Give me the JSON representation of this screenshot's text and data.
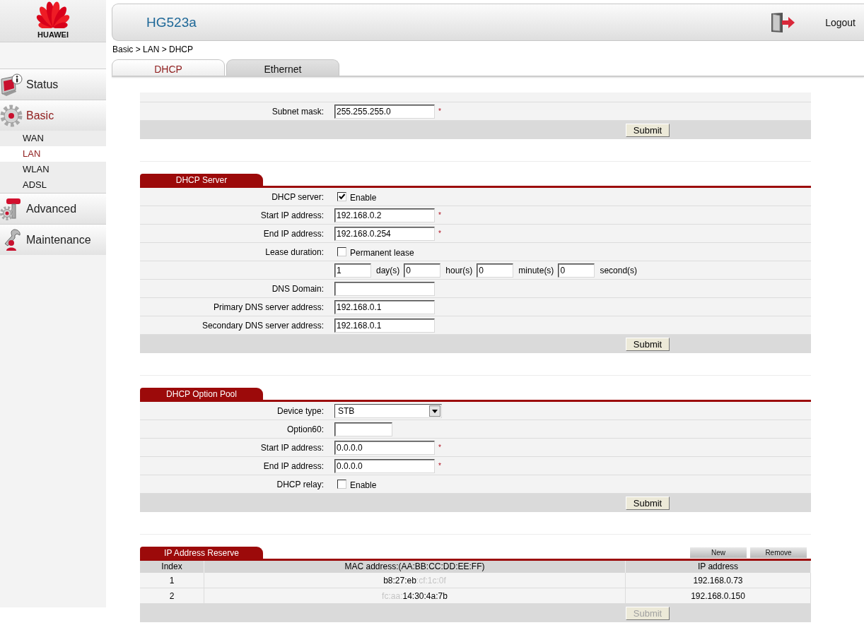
{
  "logo": {
    "text": "HUAWEI"
  },
  "sidebar": {
    "items": [
      {
        "label": "Status",
        "selected": false
      },
      {
        "label": "Basic",
        "selected": true,
        "children": [
          {
            "label": "WAN",
            "selected": false
          },
          {
            "label": "LAN",
            "selected": true
          },
          {
            "label": "WLAN",
            "selected": false
          },
          {
            "label": "ADSL",
            "selected": false
          }
        ]
      },
      {
        "label": "Advanced",
        "selected": false
      },
      {
        "label": "Maintenance",
        "selected": false
      }
    ]
  },
  "header": {
    "title": "HG523a",
    "logout": "Logout"
  },
  "breadcrumb": "Basic > LAN > DHCP",
  "tabs": [
    {
      "label": "DHCP",
      "selected": true
    },
    {
      "label": "Ethernet",
      "selected": false
    }
  ],
  "sections": [
    {
      "rows": [
        {
          "kind": "text",
          "label": "Subnet mask:",
          "value": "255.255.255.0",
          "marker": "*"
        }
      ],
      "submit": {
        "label": "Submit",
        "disabled": false
      }
    },
    {
      "title": "DHCP Server",
      "rows": [
        {
          "kind": "checkbox",
          "label": "DHCP server:",
          "checked": true,
          "text": "Enable"
        },
        {
          "kind": "text",
          "label": "Start IP address:",
          "value": "192.168.0.2",
          "marker": "*"
        },
        {
          "kind": "text",
          "label": "End IP address:",
          "value": "192.168.0.254",
          "marker": "*"
        },
        {
          "kind": "checkbox",
          "label": "Lease duration:",
          "checked": false,
          "text": "Permanent lease"
        },
        {
          "kind": "duration",
          "fields": [
            {
              "value": "1",
              "unit": "day(s)"
            },
            {
              "value": "0",
              "unit": "hour(s)"
            },
            {
              "value": "0",
              "unit": "minute(s)"
            },
            {
              "value": "0",
              "unit": "second(s)"
            }
          ]
        },
        {
          "kind": "text",
          "label": "DNS Domain:"
        },
        {
          "kind": "text",
          "label": "Primary DNS server address:",
          "value": "192.168.0.1"
        },
        {
          "kind": "text",
          "label": "Secondary DNS server address:",
          "value": "192.168.0.1"
        }
      ],
      "submit": {
        "label": "Submit",
        "disabled": false
      }
    },
    {
      "title": "DHCP Option Pool",
      "rows": [
        {
          "kind": "select",
          "label": "Device type:",
          "value": "STB"
        },
        {
          "kind": "short",
          "label": "Option60:"
        },
        {
          "kind": "text",
          "label": "Start IP address:",
          "value": "0.0.0.0",
          "marker": "*"
        },
        {
          "kind": "text",
          "label": "End IP address:",
          "value": "0.0.0.0",
          "marker": "*"
        },
        {
          "kind": "checkbox",
          "label": "DHCP relay:",
          "checked": false,
          "text": "Enable"
        }
      ],
      "submit": {
        "label": "Submit",
        "disabled": false
      }
    }
  ],
  "reserve": {
    "title": "IP Address Reserve",
    "buttons": [
      "New",
      "Remove"
    ],
    "columns": [
      "Index",
      "MAC address:(AA:BB:CC:DD:EE:FF)",
      "IP address"
    ],
    "rows": [
      {
        "index": "1",
        "mac": "b8:27:eb",
        "mac_faded_end": ":cf:1c:0f",
        "ip": "192.168.0.73"
      },
      {
        "index": "2",
        "mac_faded_start": "fc:aa:",
        "mac": "14:30:4a:7b",
        "ip": "192.168.0.150"
      }
    ],
    "submit": {
      "label": "Submit",
      "disabled": true
    }
  }
}
